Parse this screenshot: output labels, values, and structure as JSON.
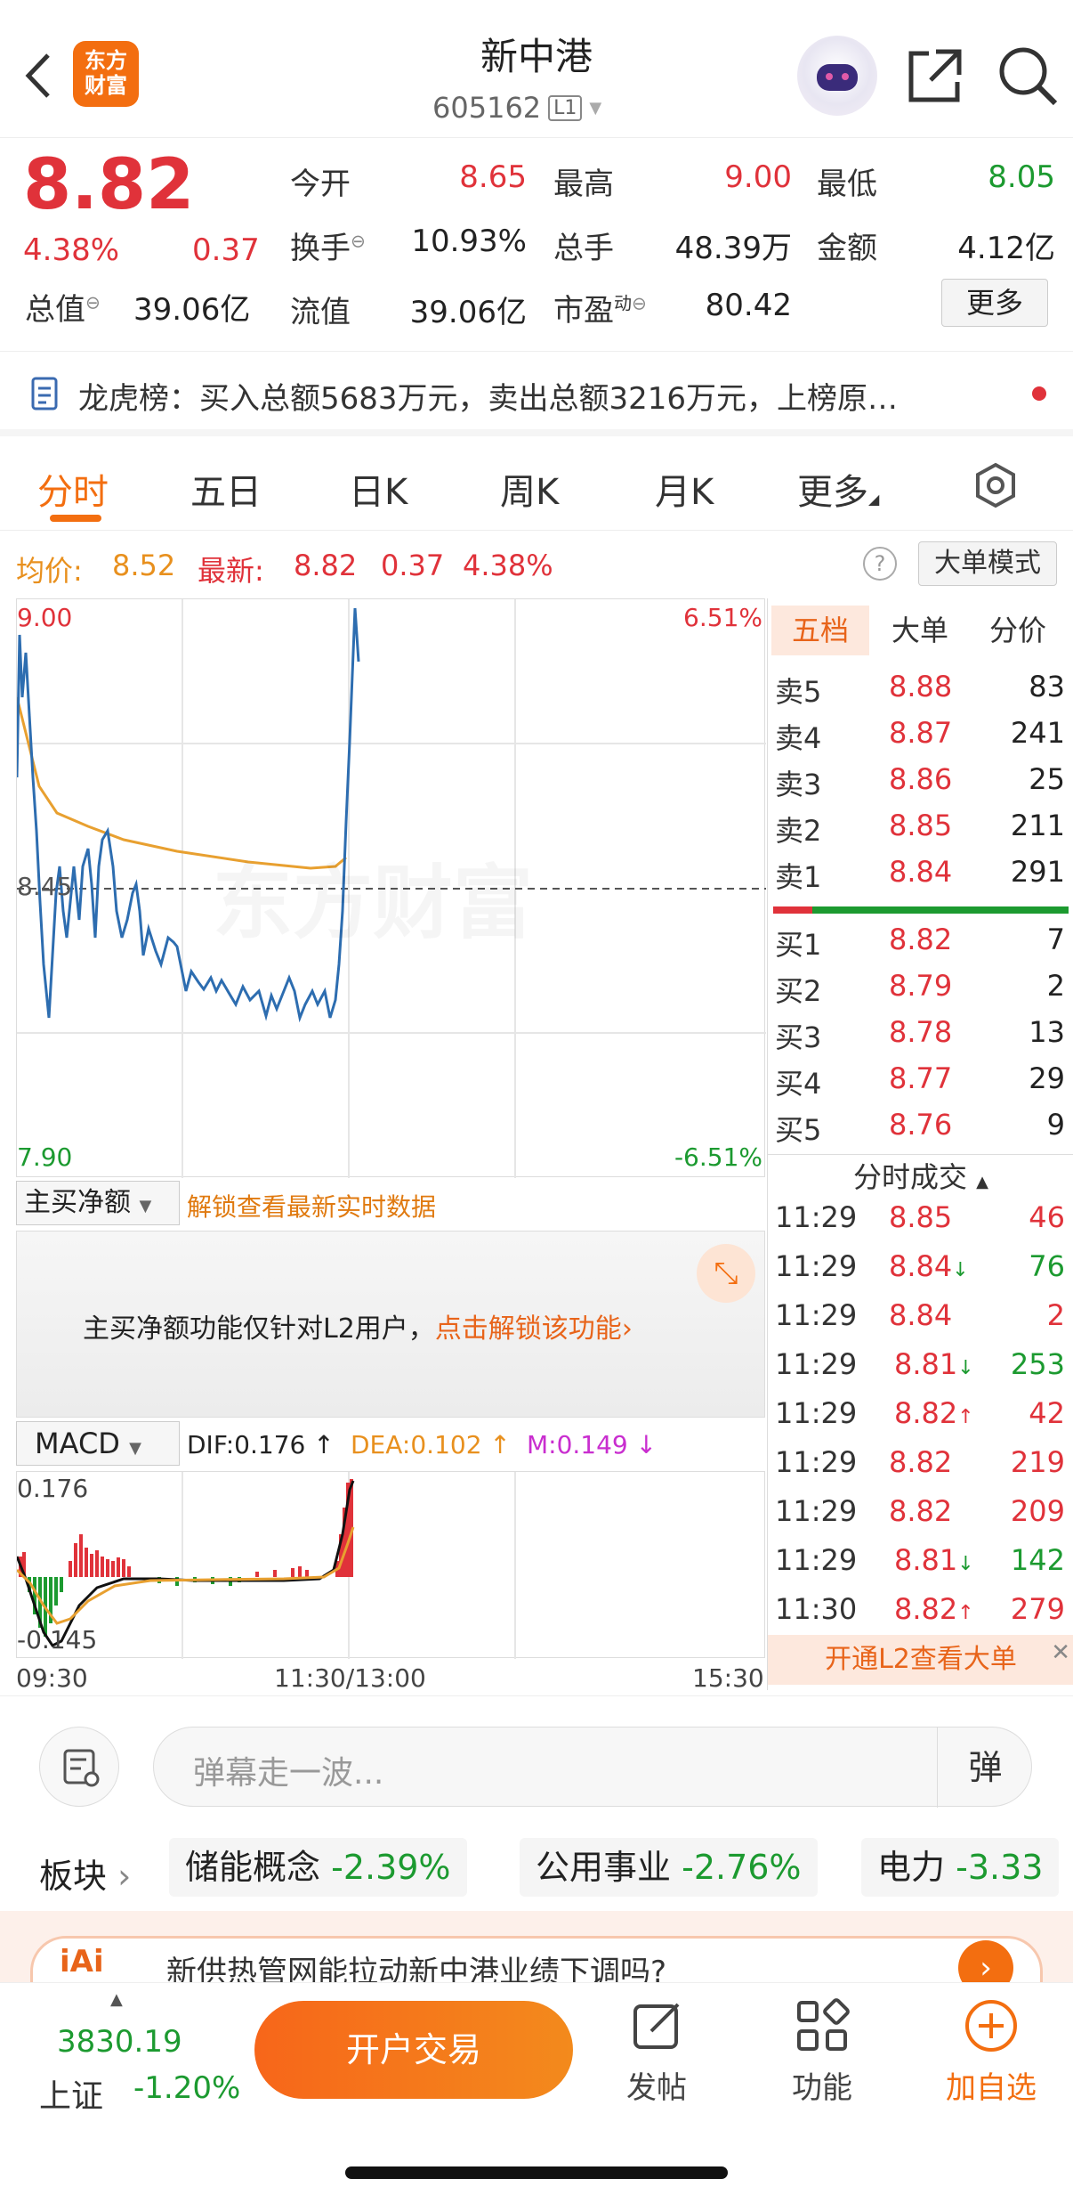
{
  "header": {
    "logo_line1": "东方",
    "logo_line2": "财富",
    "title": "新中港",
    "code": "605162",
    "level": "L1"
  },
  "quote": {
    "price": "8.82",
    "change_pct": "4.38%",
    "change": "0.37",
    "open_label": "今开",
    "open": "8.65",
    "high_label": "最高",
    "high": "9.00",
    "low_label": "最低",
    "low": "8.05",
    "turnover_label": "换手",
    "turnover": "10.93%",
    "volume_label": "总手",
    "volume": "48.39万",
    "amount_label": "金额",
    "amount": "4.12亿",
    "mktcap_label": "总值",
    "mktcap": "39.06亿",
    "float_label": "流值",
    "float": "39.06亿",
    "pe_label": "市盈",
    "pe_sup": "动",
    "pe": "80.42",
    "more_label": "更多"
  },
  "notice": {
    "text": "龙虎榜：买入总额5683万元，卖出总额3216万元，上榜原…"
  },
  "tabs": [
    {
      "label": "分时",
      "active": true
    },
    {
      "label": "五日"
    },
    {
      "label": "日K"
    },
    {
      "label": "周K"
    },
    {
      "label": "月K"
    },
    {
      "label": "更多"
    }
  ],
  "infobar": {
    "avg_label": "均价:",
    "avg": "8.52",
    "last_label": "最新:",
    "last": "8.82",
    "chg": "0.37",
    "pct": "4.38%",
    "mode_btn": "大单模式"
  },
  "chart": {
    "ymax": "9.00",
    "ymid": "8.45",
    "ymin": "7.90",
    "pmax": "6.51%",
    "pmin": "-6.51%",
    "watermark": "东方财富"
  },
  "order_tabs": [
    "五档",
    "大单",
    "分价"
  ],
  "asks": [
    {
      "label": "卖5",
      "price": "8.88",
      "vol": "83"
    },
    {
      "label": "卖4",
      "price": "8.87",
      "vol": "241"
    },
    {
      "label": "卖3",
      "price": "8.86",
      "vol": "25"
    },
    {
      "label": "卖2",
      "price": "8.85",
      "vol": "211"
    },
    {
      "label": "卖1",
      "price": "8.84",
      "vol": "291"
    }
  ],
  "bids": [
    {
      "label": "买1",
      "price": "8.82",
      "vol": "7"
    },
    {
      "label": "买2",
      "price": "8.79",
      "vol": "2"
    },
    {
      "label": "买3",
      "price": "8.78",
      "vol": "13"
    },
    {
      "label": "买4",
      "price": "8.77",
      "vol": "29"
    },
    {
      "label": "买5",
      "price": "8.76",
      "vol": "9"
    }
  ],
  "ticks_title": "分时成交",
  "ticks": [
    {
      "time": "11:29",
      "price": "8.85",
      "arrow": "",
      "vol": "46",
      "c": "red"
    },
    {
      "time": "11:29",
      "price": "8.84",
      "arrow": "↓",
      "vol": "76",
      "c": "green"
    },
    {
      "time": "11:29",
      "price": "8.84",
      "arrow": "",
      "vol": "2",
      "c": "red"
    },
    {
      "time": "11:29",
      "price": "8.81",
      "arrow": "↓",
      "vol": "253",
      "c": "green"
    },
    {
      "time": "11:29",
      "price": "8.82",
      "arrow": "↑",
      "vol": "42",
      "c": "red"
    },
    {
      "time": "11:29",
      "price": "8.82",
      "arrow": "",
      "vol": "219",
      "c": "red"
    },
    {
      "time": "11:29",
      "price": "8.82",
      "arrow": "",
      "vol": "209",
      "c": "red"
    },
    {
      "time": "11:29",
      "price": "8.81",
      "arrow": "↓",
      "vol": "142",
      "c": "green"
    },
    {
      "time": "11:30",
      "price": "8.82",
      "arrow": "↑",
      "vol": "279",
      "c": "red"
    }
  ],
  "l2_banner": "开通L2查看大单",
  "netbuy": {
    "select": "主买净额",
    "unlock": "解锁查看最新实时数据",
    "locked_text": "主买净额功能仅针对L2用户，",
    "locked_link": "点击解锁该功能"
  },
  "macd": {
    "select": "MACD",
    "dif": "DIF:0.176 ↑",
    "dea": "DEA:0.102 ↑",
    "m": "M:0.149 ↓",
    "top": "0.176",
    "bottom": "-0.145"
  },
  "xaxis": {
    "start": "09:30",
    "mid": "11:30/13:00",
    "end": "15:30"
  },
  "comment": {
    "placeholder": "弹幕走一波..."
  },
  "sectors": {
    "label": "板块",
    "items": [
      {
        "name": "储能概念",
        "pct": "-2.39%"
      },
      {
        "name": "公用事业",
        "pct": "-2.76%"
      },
      {
        "name": "电力",
        "pct": "-3.33"
      }
    ]
  },
  "ai_banner": "新供热管网能拉动新中港业绩下调吗?",
  "bottom": {
    "index_value": "3830.19",
    "index_name": "上证",
    "index_pct": "-1.20%",
    "trade_btn": "开户交易",
    "post": "发帖",
    "func": "功能",
    "watch": "加自选"
  },
  "colors": {
    "red": "#e0323a",
    "green": "#1c9a30",
    "orange": "#f36e10",
    "avg_line": "#e8a030",
    "price_line": "#2d6db0"
  }
}
